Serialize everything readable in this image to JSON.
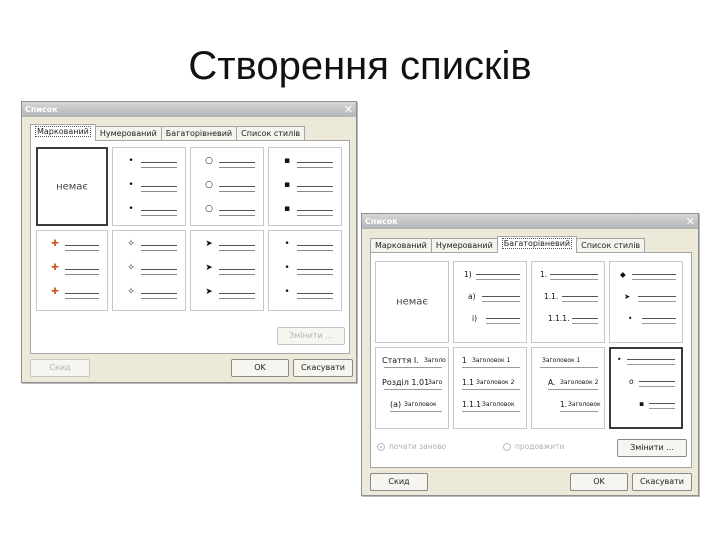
{
  "slide": {
    "title": "Створення списків"
  },
  "dialog1": {
    "title": "Список",
    "tabs": [
      "Маркований",
      "Нумерований",
      "Багаторівневий",
      "Список стилів"
    ],
    "none_label": "немає",
    "row1_bullets": [
      "•",
      "○",
      "▪"
    ],
    "row2_bullets": [
      "✚",
      "✧",
      "➤",
      "•"
    ],
    "change_label": "Змінити ...",
    "reset_label": "Скид",
    "ok_label": "OK",
    "cancel_label": "Скасувати"
  },
  "dialog2": {
    "title": "Список",
    "tabs": [
      "Маркований",
      "Нумерований",
      "Багаторівневий",
      "Список стилів"
    ],
    "none_label": "немає",
    "cell_numbered": [
      "1)",
      "a)",
      "i)"
    ],
    "cell_decimal": [
      "1.",
      "1.1.",
      "1.1.1."
    ],
    "cell_symbols": [
      "◆",
      "➤",
      "•"
    ],
    "cell_article": [
      {
        "label": "Стаття І.",
        "sub": "Заголо"
      },
      {
        "label": "Розділ 1.01",
        "sub": "Заго"
      },
      {
        "label": "(a)",
        "sub": "Заголовок"
      }
    ],
    "cell_heading1": [
      {
        "label": "1",
        "sub": "Заголовок 1"
      },
      {
        "label": "1.1",
        "sub": "Заголовок 2"
      },
      {
        "label": "1.1.1",
        "sub": "Заголовок"
      }
    ],
    "cell_heading2": [
      {
        "label": "",
        "sub": "Заголовок 1"
      },
      {
        "label": "A.",
        "sub": "Заголовок 2"
      },
      {
        "label": "1.",
        "sub": "Заголовок"
      }
    ],
    "cell_selected": [
      "•",
      "o",
      "▪"
    ],
    "radio_restart": "почати заново",
    "radio_continue": "продовжити",
    "change_label": "Змінити ...",
    "reset_label": "Скид",
    "ok_label": "OK",
    "cancel_label": "Скасувати"
  }
}
